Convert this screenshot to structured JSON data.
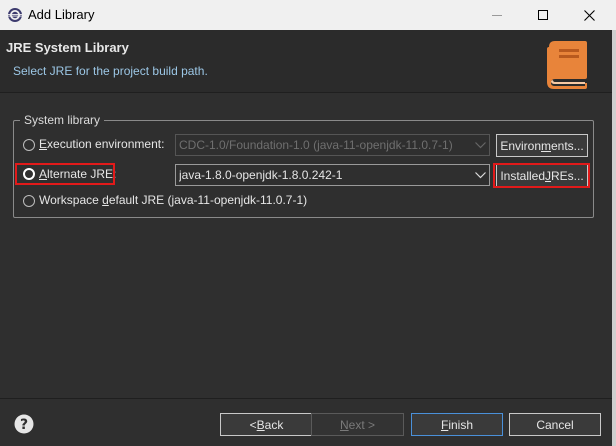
{
  "window": {
    "title": "Add Library"
  },
  "header": {
    "title": "JRE System Library",
    "description": "Select JRE for the project build path."
  },
  "group": {
    "legend": "System library",
    "options": [
      {
        "label_pre": "",
        "label_ul": "E",
        "label_post": "xecution environment:",
        "selected": false
      },
      {
        "label_pre": "",
        "label_ul": "A",
        "label_post": "lternate JRE:",
        "selected": true
      },
      {
        "label_pre": "Workspace ",
        "label_ul": "d",
        "label_post": "efault JRE (java-11-openjdk-11.0.7-1)",
        "selected": false
      }
    ],
    "execution_env_value": "CDC-1.0/Foundation-1.0 (java-11-openjdk-11.0.7-1)",
    "alternate_jre_value": "java-1.8.0-openjdk-1.8.0.242-1",
    "environments_button_pre": "Environ",
    "environments_button_ul": "m",
    "environments_button_post": "ents...",
    "installed_jres_button_pre": "Installed ",
    "installed_jres_button_ul": "J",
    "installed_jres_button_post": "REs..."
  },
  "footer": {
    "back_pre": "< ",
    "back_ul": "B",
    "back_post": "ack",
    "next_ul": "N",
    "next_post": "ext >",
    "finish_ul": "F",
    "finish_post": "inish",
    "cancel_label": "Cancel"
  },
  "colors": {
    "background": "#2f2f2f",
    "header_background": "#2b2b2b",
    "highlight": "#e21a1a",
    "link_text": "#9cc7e6",
    "book_icon": "#e8843a"
  }
}
